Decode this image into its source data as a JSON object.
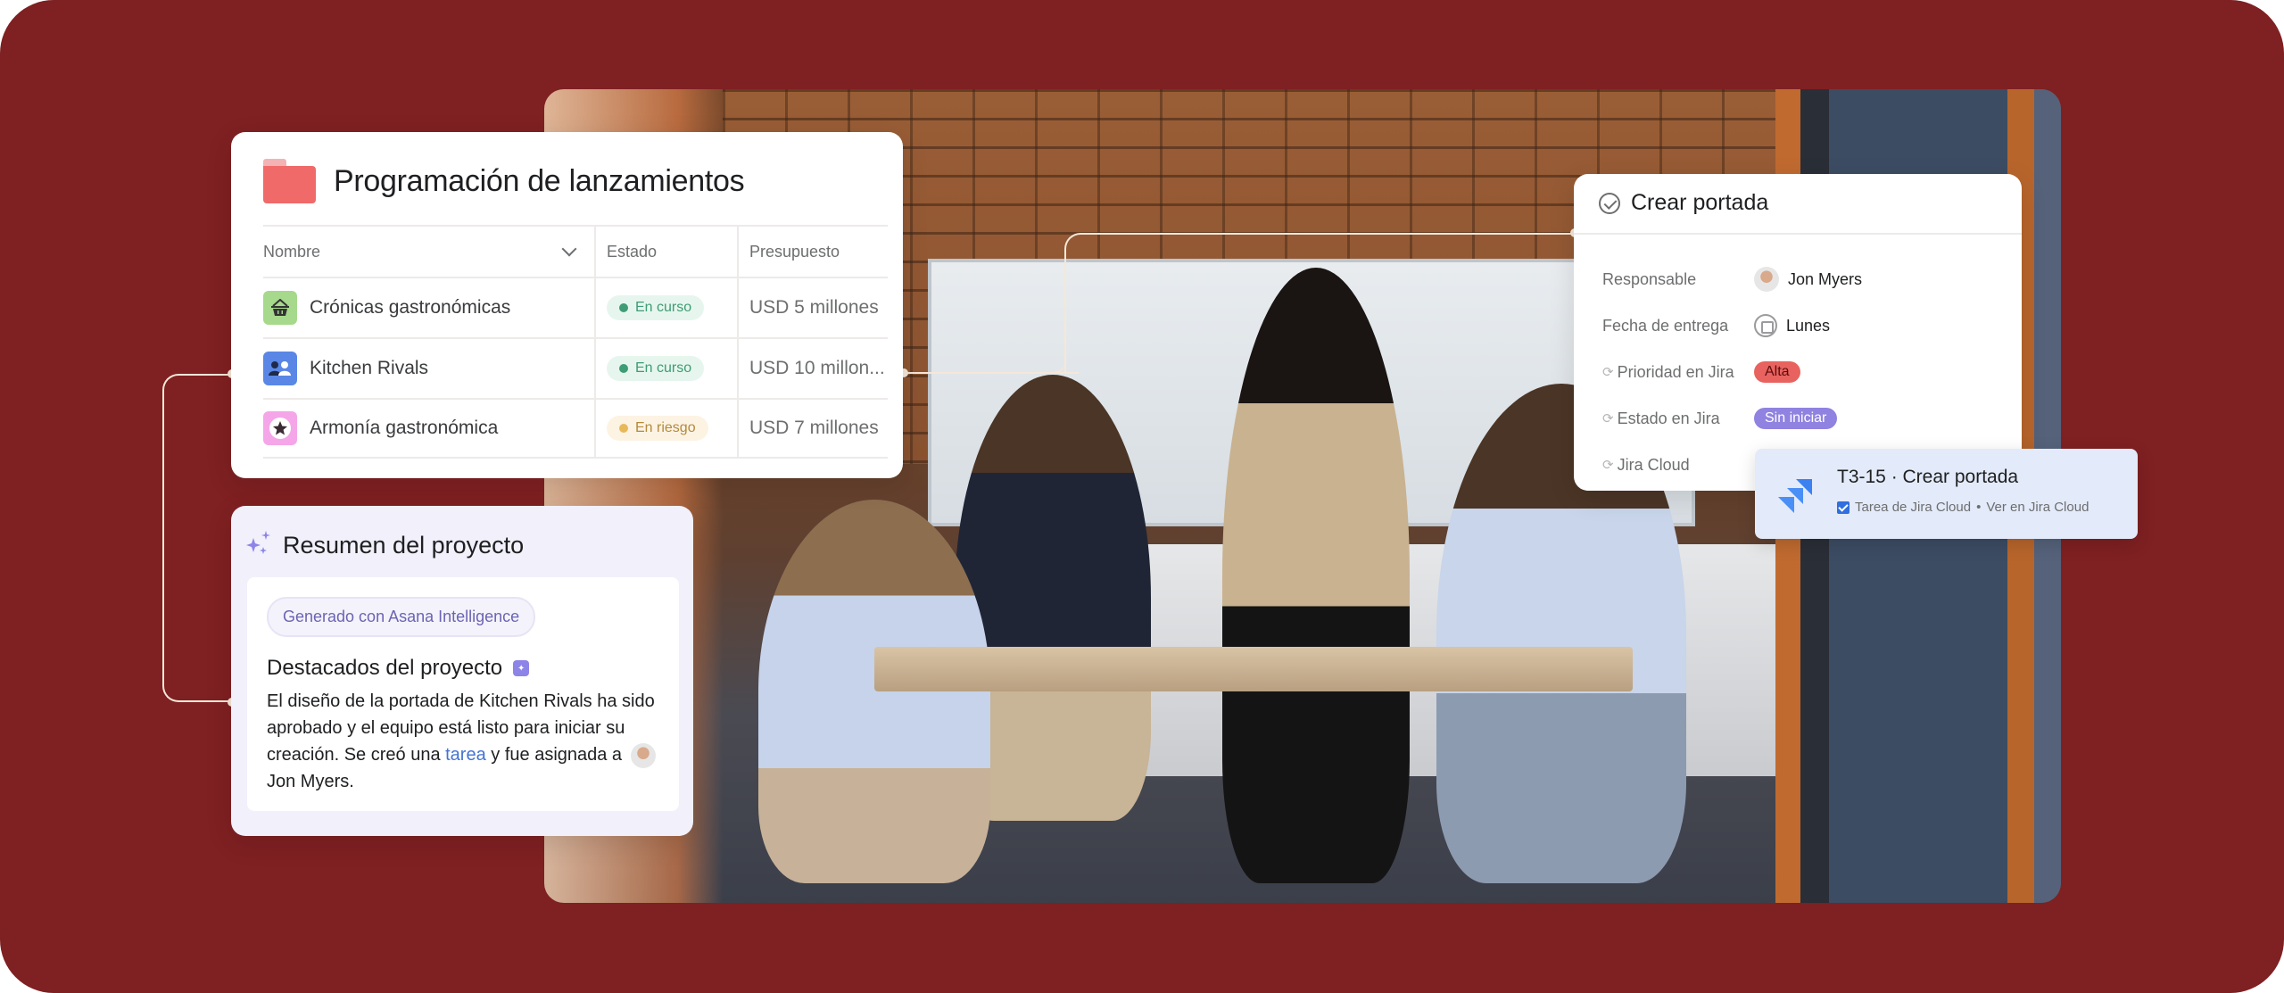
{
  "colors": {
    "background": "#7f2022",
    "folder": "#f06a6a",
    "ai_purple": "#8d84e8",
    "link_blue": "#4573d2",
    "jira_blue": "#2f6fdf",
    "alta_red": "#e8635f",
    "sin_iniciar_purple": "#8f82e0"
  },
  "project_card": {
    "icon": "folder-icon",
    "title": "Programación de lanzamientos",
    "columns": [
      "Nombre",
      "Estado",
      "Presupuesto"
    ],
    "rows": [
      {
        "icon": "basket-icon",
        "icon_glyph": "🧺",
        "icon_bg": "#a6d98b",
        "name": "Crónicas gastronómicas",
        "status": "En curso",
        "status_color": "#3f9c74",
        "status_bg": "#e6f6ee",
        "budget": "USD 5 millones"
      },
      {
        "icon": "people-icon",
        "icon_glyph": "👥",
        "icon_bg": "#5a87e6",
        "name": "Kitchen Rivals",
        "status": "En curso",
        "status_color": "#3f9c74",
        "status_bg": "#e6f6ee",
        "budget": "USD 10 millon..."
      },
      {
        "icon": "star-icon",
        "icon_glyph": "★",
        "icon_bg": "#f5a6e8",
        "name": "Armonía gastronómica",
        "status": "En riesgo",
        "status_color": "#e8b95a",
        "status_bg": "#fdf3e3",
        "budget": "USD 7 millones"
      }
    ]
  },
  "summary_card": {
    "icon": "sparkle-icon",
    "title": "Resumen del proyecto",
    "ai_chip": "Generado con Asana Intelligence",
    "highlights_title": "Destacados del proyecto",
    "body_before_link": "El diseño de la portada de Kitchen Rivals ha sido aprobado y el equipo está listo para iniciar su creación. Se creó una ",
    "link_text": "tarea",
    "body_after_link": " y fue asignada a ",
    "assignee": "Jon Myers."
  },
  "task_card": {
    "title": "Crear portada",
    "fields": [
      {
        "label": "Responsable",
        "value": "Jon Myers",
        "synced": false
      },
      {
        "label": "Fecha de entrega",
        "value": "Lunes",
        "synced": false
      },
      {
        "label": "Prioridad en Jira",
        "value": "Alta",
        "synced": true
      },
      {
        "label": "Estado en Jira",
        "value": "Sin iniciar",
        "synced": true
      },
      {
        "label": "Jira Cloud",
        "value": "",
        "synced": true
      }
    ]
  },
  "jira_popover": {
    "title": "T3-15 · Crear portada",
    "type": "Tarea de Jira Cloud",
    "separator": "•",
    "link": "Ver en Jira Cloud"
  }
}
